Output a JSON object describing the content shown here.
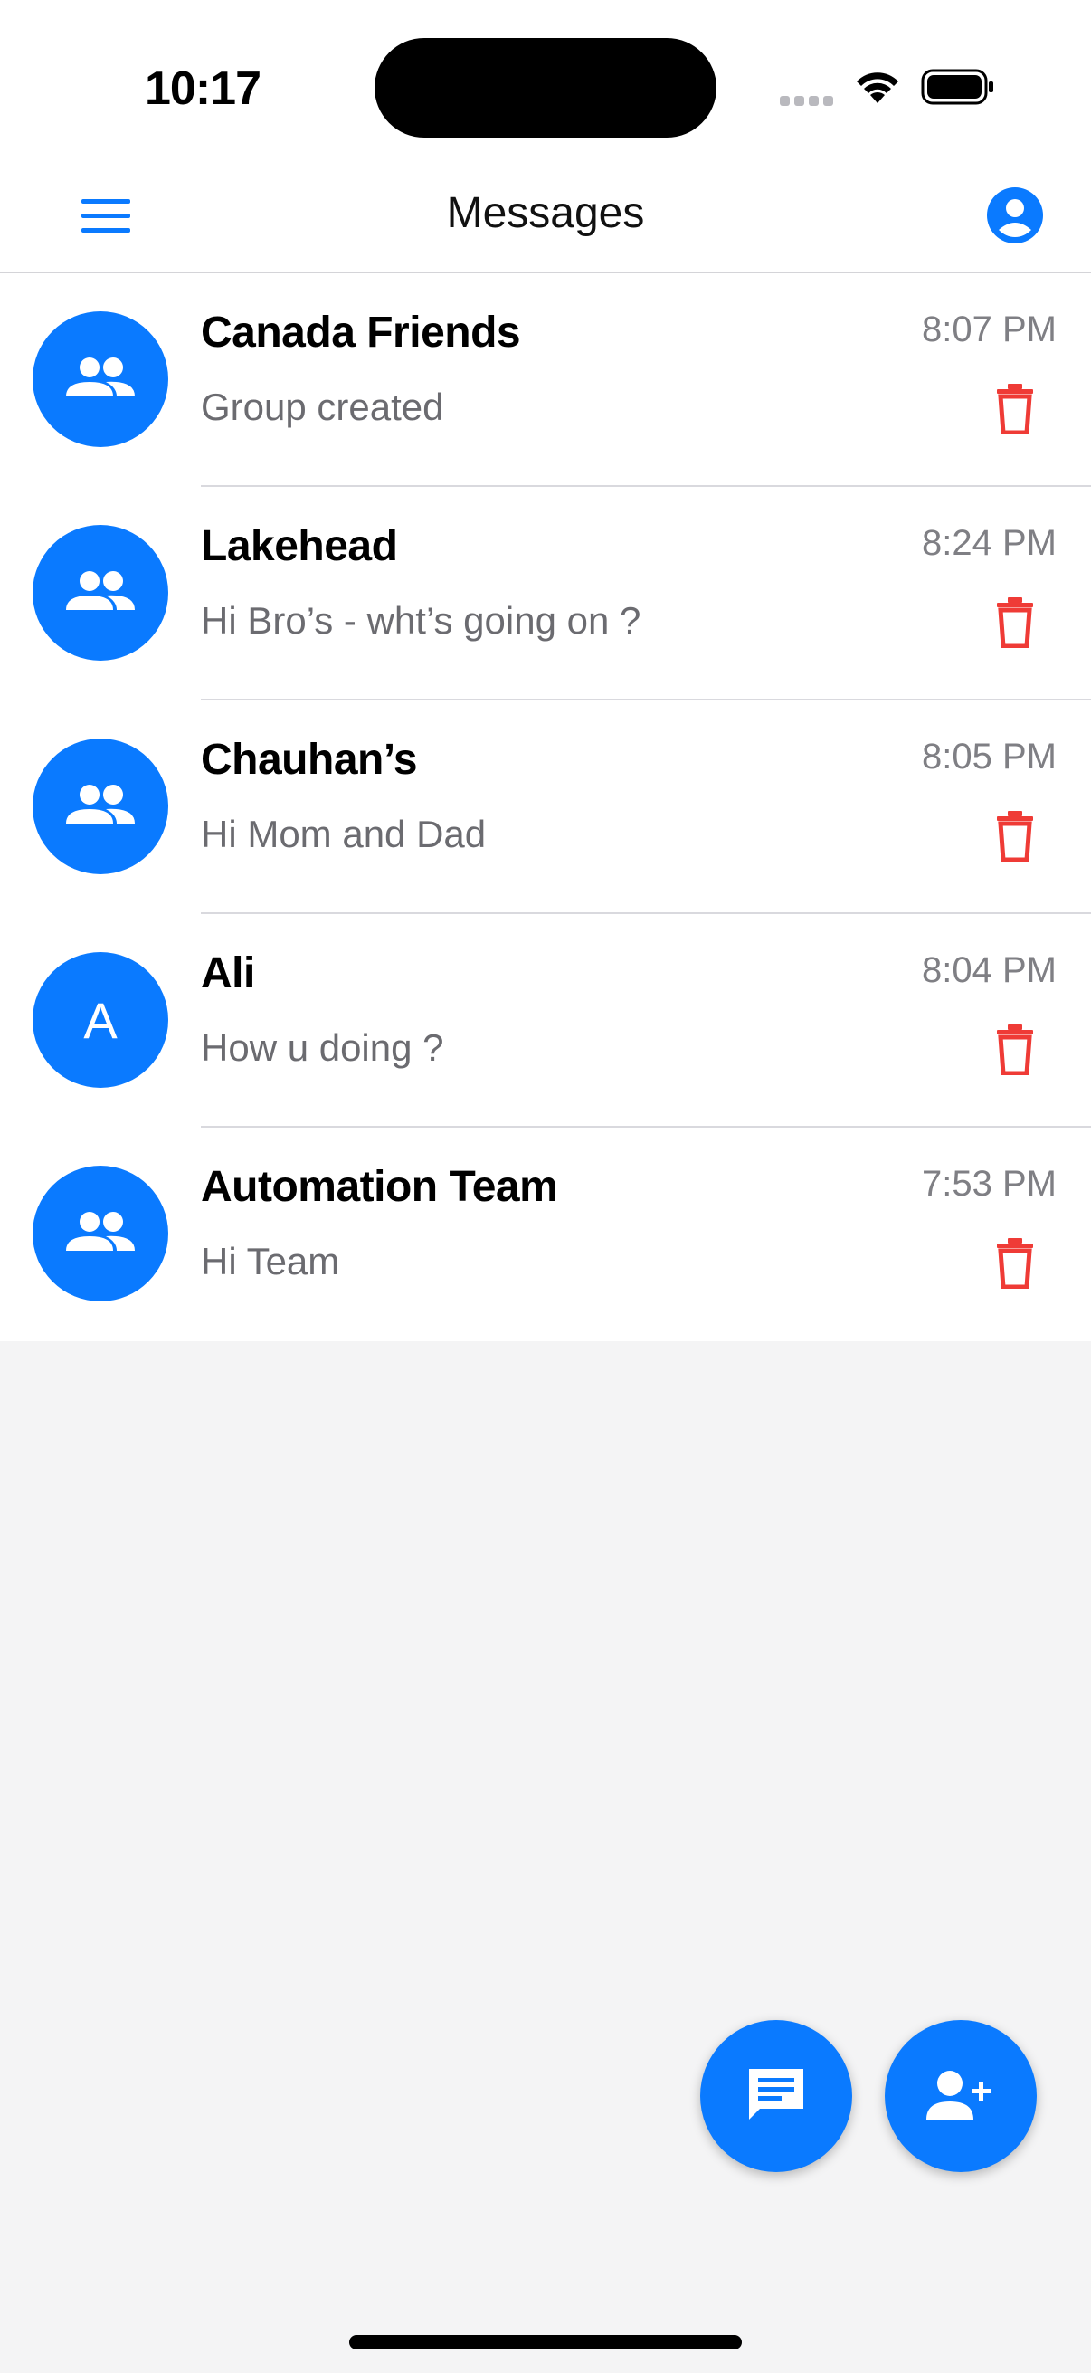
{
  "status_bar": {
    "time": "10:17"
  },
  "header": {
    "title": "Messages"
  },
  "conversations": [
    {
      "name": "Canada Friends",
      "preview": "Group created",
      "time": "8:07 PM",
      "avatar_type": "group-icon",
      "initial": ""
    },
    {
      "name": "Lakehead",
      "preview": "Hi Bro’s - wht’s going on ?",
      "time": "8:24 PM",
      "avatar_type": "group-icon",
      "initial": ""
    },
    {
      "name": "Chauhan’s",
      "preview": "Hi Mom and Dad",
      "time": "8:05 PM",
      "avatar_type": "group-icon",
      "initial": ""
    },
    {
      "name": "Ali",
      "preview": "How u doing ?",
      "time": "8:04 PM",
      "avatar_type": "initial",
      "initial": "A"
    },
    {
      "name": "Automation Team",
      "preview": "Hi Team",
      "time": "7:53 PM",
      "avatar_type": "group-icon",
      "initial": ""
    }
  ],
  "colors": {
    "accent": "#0a7aff",
    "delete": "#ef3b36",
    "background": "#f4f4f5"
  },
  "fabs": {
    "new_message_icon": "chat-icon",
    "add_contact_icon": "person-add-icon"
  }
}
